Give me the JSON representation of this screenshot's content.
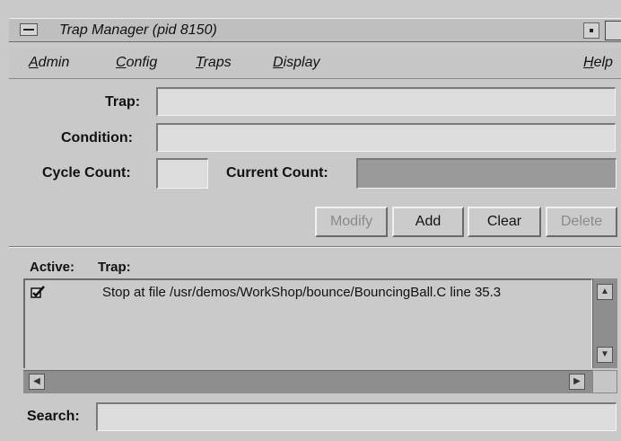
{
  "window": {
    "title": "Trap Manager (pid 8150)"
  },
  "menubar": {
    "items": [
      {
        "first": "A",
        "rest": "dmin"
      },
      {
        "first": "C",
        "rest": "onfig"
      },
      {
        "first": "T",
        "rest": "raps"
      },
      {
        "first": "D",
        "rest": "isplay"
      },
      {
        "first": "H",
        "rest": "elp"
      }
    ]
  },
  "form": {
    "trap_label": "Trap:",
    "trap_value": "",
    "condition_label": "Condition:",
    "condition_value": "",
    "cycle_count_label": "Cycle Count:",
    "cycle_count_value": "",
    "current_count_label": "Current Count:",
    "current_count_value": ""
  },
  "actions": {
    "modify": "Modify",
    "add": "Add",
    "clear": "Clear",
    "delete": "Delete"
  },
  "list": {
    "active_header": "Active:",
    "trap_header": "Trap:",
    "rows": [
      {
        "active": true,
        "trap": "Stop at file /usr/demos/WorkShop/bounce/BouncingBall.C line 35.3"
      }
    ]
  },
  "search": {
    "label": "Search:",
    "value": ""
  }
}
